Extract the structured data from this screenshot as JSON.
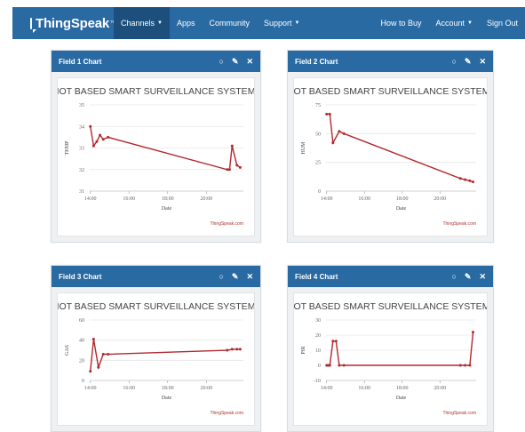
{
  "navbar": {
    "brand": "ThingSpeak",
    "brand_mark": "™",
    "items": [
      {
        "label": "Channels",
        "dropdown": true,
        "active": true
      },
      {
        "label": "Apps",
        "dropdown": false,
        "active": false
      },
      {
        "label": "Community",
        "dropdown": false,
        "active": false
      },
      {
        "label": "Support",
        "dropdown": true,
        "active": false
      }
    ],
    "right_items": [
      {
        "label": "How to Buy",
        "dropdown": false
      },
      {
        "label": "Account",
        "dropdown": true
      },
      {
        "label": "Sign Out",
        "dropdown": false
      }
    ]
  },
  "colors": {
    "navbar": "#2a6aa3",
    "active_nav": "#1d4f7c",
    "line": "#b2282d",
    "grid": "#e6e6e6"
  },
  "panel_tools": [
    "comment-icon",
    "pencil-icon",
    "close-icon"
  ],
  "panel_tool_glyphs": {
    "comment-icon": "○",
    "pencil-icon": "✎",
    "close-icon": "✕"
  },
  "charts": [
    {
      "panel_title": "Field 1 Chart"
    },
    {
      "panel_title": "Field 2 Chart"
    },
    {
      "panel_title": "Field 3 Chart"
    },
    {
      "panel_title": "Field 4 Chart"
    }
  ],
  "chart_data": [
    {
      "type": "line",
      "title": "IOT BASED SMART SURVEILLANCE SYSTEM",
      "xlabel": "Date",
      "ylabel": "TEMP",
      "credit": "ThingSpeak.com",
      "x_ticks": [
        "14:00",
        "16:00",
        "18:00",
        "20:00"
      ],
      "y_ticks": [
        31,
        32,
        33,
        34,
        35
      ],
      "ylim": [
        31,
        35
      ],
      "xlim": [
        "13:58",
        "21:55"
      ],
      "grid": true,
      "x": [
        "14:00",
        "14:10",
        "14:20",
        "14:30",
        "14:40",
        "14:55",
        "21:05",
        "21:12",
        "21:20",
        "21:35",
        "21:45"
      ],
      "values": [
        34.0,
        33.1,
        33.3,
        33.6,
        33.4,
        33.5,
        32.0,
        32.0,
        33.1,
        32.2,
        32.1
      ]
    },
    {
      "type": "line",
      "title": "IOT BASED SMART SURVEILLANCE SYSTEM",
      "xlabel": "Date",
      "ylabel": "HUM",
      "credit": "ThingSpeak.com",
      "x_ticks": [
        "14:00",
        "16:00",
        "18:00",
        "20:00"
      ],
      "y_ticks": [
        0,
        25,
        50,
        75
      ],
      "ylim": [
        0,
        75
      ],
      "xlim": [
        "13:58",
        "21:55"
      ],
      "grid": true,
      "x": [
        "14:00",
        "14:10",
        "14:20",
        "14:40",
        "14:55",
        "21:05",
        "21:20",
        "21:35",
        "21:45"
      ],
      "values": [
        67,
        67,
        42,
        52,
        50,
        11,
        10,
        9,
        8
      ]
    },
    {
      "type": "line",
      "title": "IOT BASED SMART SURVEILLANCE SYSTEM",
      "xlabel": "Date",
      "ylabel": "GAS",
      "credit": "ThingSpeak.com",
      "x_ticks": [
        "14:00",
        "16:00",
        "18:00",
        "20:00"
      ],
      "y_ticks": [
        0,
        20,
        40,
        60
      ],
      "ylim": [
        0,
        60
      ],
      "xlim": [
        "13:58",
        "21:55"
      ],
      "grid": true,
      "x": [
        "14:00",
        "14:10",
        "14:25",
        "14:40",
        "14:55",
        "21:05",
        "21:20",
        "21:35",
        "21:45"
      ],
      "values": [
        9,
        41,
        13,
        26,
        26,
        30,
        31,
        31,
        31
      ]
    },
    {
      "type": "line",
      "title": "IOT BASED SMART SURVEILLANCE SYSTEM",
      "xlabel": "Date",
      "ylabel": "PIR",
      "credit": "ThingSpeak.com",
      "x_ticks": [
        "14:00",
        "16:00",
        "18:00",
        "20:00"
      ],
      "y_ticks": [
        -10,
        0,
        10,
        20,
        30
      ],
      "ylim": [
        -10,
        30
      ],
      "xlim": [
        "13:58",
        "21:55"
      ],
      "grid": true,
      "x": [
        "14:00",
        "14:05",
        "14:10",
        "14:20",
        "14:30",
        "14:40",
        "14:55",
        "21:05",
        "21:20",
        "21:35",
        "21:45"
      ],
      "values": [
        0,
        0,
        0,
        16,
        16,
        0,
        0,
        0,
        0,
        0,
        22
      ]
    }
  ]
}
